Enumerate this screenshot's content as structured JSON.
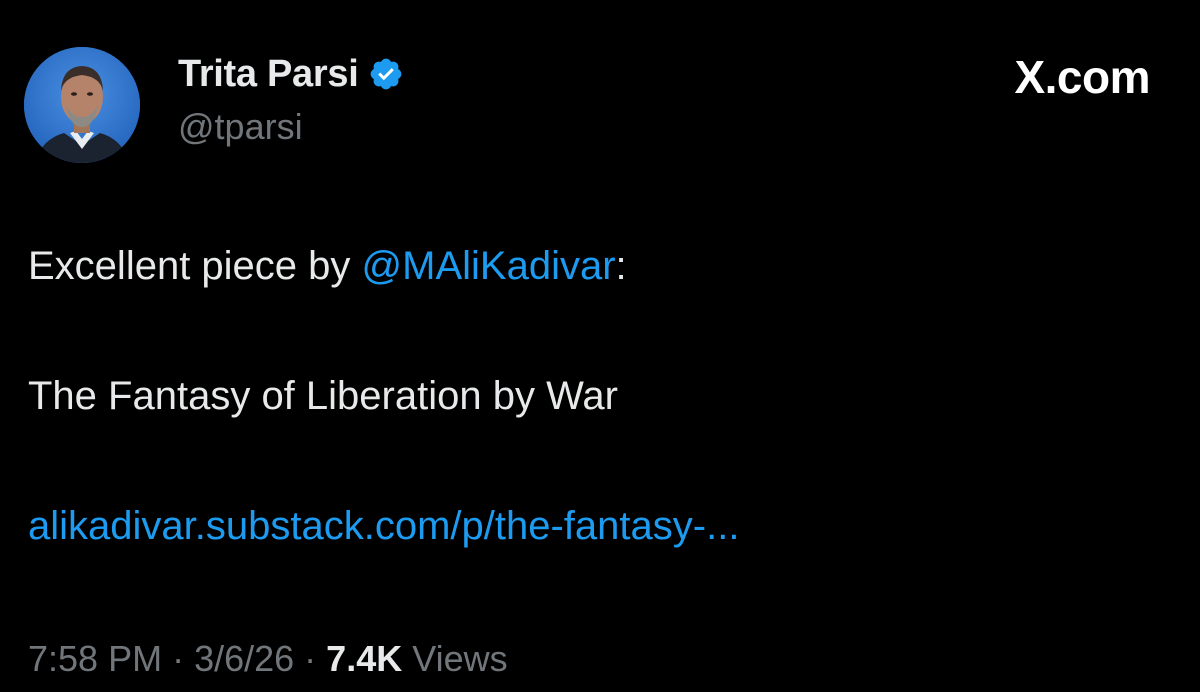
{
  "author": {
    "display_name": "Trita Parsi",
    "handle": "@tparsi",
    "verified_icon": "verified-badge-icon",
    "avatar": "profile-photo"
  },
  "brand": "X.com",
  "tweet": {
    "prefix": "Excellent piece by ",
    "mention": "@MAliKadivar",
    "mention_suffix": ":",
    "title_line": "The Fantasy of Liberation by War",
    "link": "alikadivar.substack.com/p/the-fantasy-..."
  },
  "meta": {
    "time": "7:58 PM",
    "separator": " · ",
    "date": "3/6/26",
    "views_count": "7.4K",
    "views_label": "Views"
  },
  "colors": {
    "background": "#000000",
    "text": "#e7e9ea",
    "muted": "#71767b",
    "link": "#1d9bf0",
    "verified": "#1d9bf0"
  }
}
